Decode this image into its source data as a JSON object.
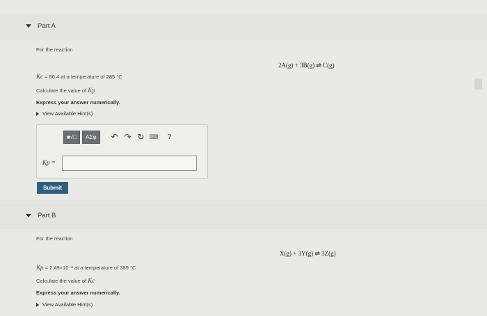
{
  "part_a": {
    "label": "Part A",
    "intro": "For the reaction",
    "reaction": "2A(g) + 3B(g) ⇌ C(g)",
    "given_sym": "Kc",
    "given_text": " = 86.4 at a temperature of 285 °C",
    "question_text": "Calculate the value of ",
    "question_sym": "Kp",
    "instruction": "Express your answer numerically.",
    "hints": "View Available Hint(s)",
    "toolbar": {
      "btn_templates": "■√□",
      "btn_greek": "AΣφ",
      "undo": "↶",
      "redo": "↷",
      "reset": "↻",
      "keyboard": "⌨",
      "help": "?"
    },
    "input_label": "Kp =",
    "input_value": "",
    "submit": "Submit"
  },
  "part_b": {
    "label": "Part B",
    "intro": "For the reaction",
    "reaction": "X(g) + 3Y(g) ⇌ 3Z(g)",
    "given_sym": "Kp",
    "given_text": " = 2.49×10⁻² at a temperature of 389 °C",
    "question_text": "Calculate the value of ",
    "question_sym": "Kc",
    "instruction": "Express your answer numerically.",
    "hints": "View Available Hint(s)"
  }
}
